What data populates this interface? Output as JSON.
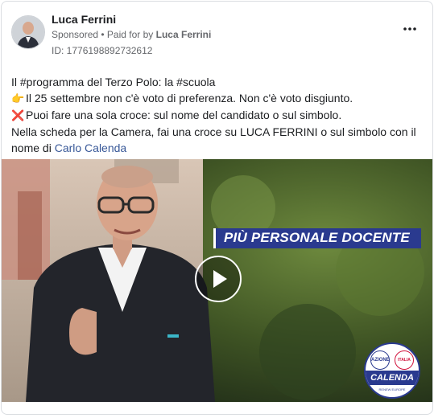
{
  "post": {
    "author_name": "Luca Ferrini",
    "sponsored_label": "Sponsored",
    "paid_for_prefix": "• Paid for by",
    "paid_for_by": "Luca Ferrini",
    "ad_id": "ID: 1776198892732612",
    "menu_icon": "more-horizontal-icon"
  },
  "text": {
    "line1": "Il #programma del Terzo Polo: la #scuola",
    "line2_emoji": "👉",
    "line2": "Il 25 settembre non c'è voto di preferenza. Non c'è voto disgiunto.",
    "line3_emoji": "❌",
    "line3": "Puoi fare una sola croce: sul nome del candidato o sul simbolo.",
    "line4": "Nella scheda per la Camera, fai una croce su LUCA FERRINI o sul simbolo con il",
    "line5_prefix": "nome di",
    "line5_link": "Carlo Calenda"
  },
  "video": {
    "overlay_text": "PIÙ PERSONALE DOCENTE",
    "play_icon": "play-icon",
    "logo": {
      "top_left": "AZIONE",
      "top_right": "ITALIA VIVA",
      "name": "CALENDA",
      "bottom": "RENEW EUROPE"
    }
  },
  "colors": {
    "accent_blue": "#2a3a8f",
    "link": "#385898",
    "muted": "#65676b"
  }
}
